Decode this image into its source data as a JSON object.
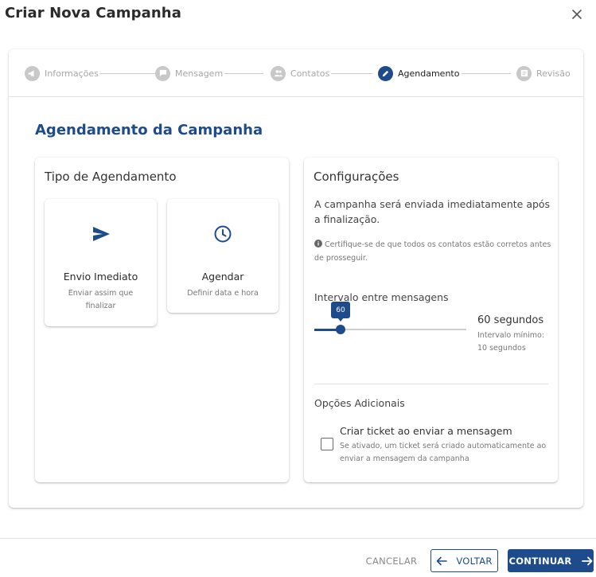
{
  "dialog": {
    "title": "Criar Nova Campanha"
  },
  "stepper": {
    "steps": [
      {
        "label": "Informações",
        "icon": "megaphone-icon",
        "active": false
      },
      {
        "label": "Mensagem",
        "icon": "message-icon",
        "active": false
      },
      {
        "label": "Contatos",
        "icon": "people-icon",
        "active": false
      },
      {
        "label": "Agendamento",
        "icon": "pencil-icon",
        "active": true
      },
      {
        "label": "Revisão",
        "icon": "list-icon",
        "active": false
      }
    ]
  },
  "section": {
    "title": "Agendamento da Campanha"
  },
  "schedule_type": {
    "title": "Tipo de Agendamento",
    "options": [
      {
        "icon": "send-icon",
        "title": "Envio Imediato",
        "desc": "Enviar assim que finalizar"
      },
      {
        "icon": "clock-icon",
        "title": "Agendar",
        "desc": "Definir data e hora"
      }
    ]
  },
  "config": {
    "title": "Configurações",
    "text": "A campanha será enviada imediatamente após a finalização.",
    "hint": "Certifique-se de que todos os contatos estão corretos antes de prosseguir.",
    "interval_label": "Intervalo entre mensagens",
    "slider": {
      "value": 60,
      "value_text": "60",
      "min": 10,
      "max": 300
    },
    "interval_value": "60 segundos",
    "interval_min": "Intervalo mínimo: 10 segundos",
    "extra_title": "Opções Adicionais",
    "ticket": {
      "label": "Criar ticket ao enviar a mensagem",
      "desc": "Se ativado, um ticket será criado automaticamente ao enviar a mensagem da campanha",
      "checked": false
    }
  },
  "footer": {
    "cancel": "CANCELAR",
    "back": "VOLTAR",
    "next": "CONTINUAR"
  },
  "colors": {
    "primary": "#1d4b8c",
    "inactive": "#c8c8c8"
  }
}
